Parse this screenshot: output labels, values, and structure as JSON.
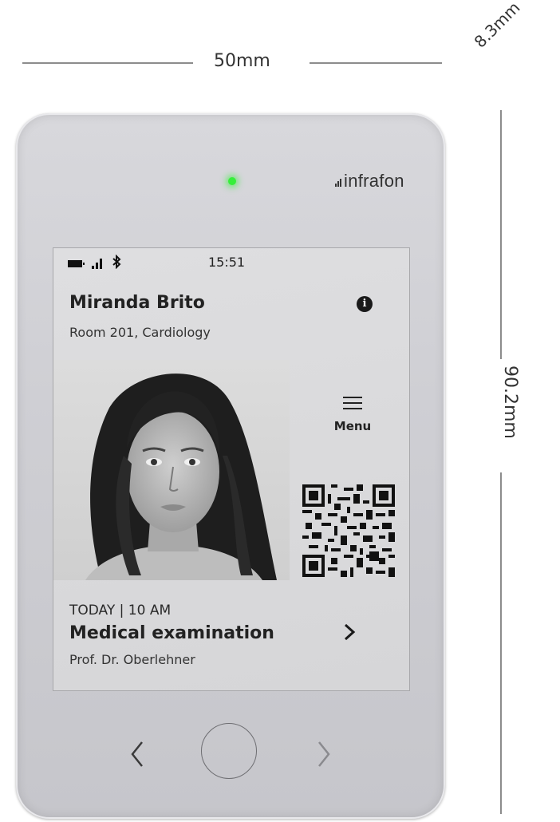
{
  "dimensions": {
    "width": "50mm",
    "height": "90.2mm",
    "depth": "8.3mm"
  },
  "device": {
    "brand": "infrafon",
    "led_color": "#36ef3a"
  },
  "status_bar": {
    "time": "15:51",
    "icons": [
      "battery-icon",
      "signal-icon",
      "bluetooth-icon"
    ]
  },
  "patient": {
    "name": "Miranda Brito",
    "room": "Room 201, Cardiology"
  },
  "menu": {
    "label": "Menu"
  },
  "appointment": {
    "time": "TODAY | 10 AM",
    "title": "Medical examination",
    "doctor": "Prof. Dr. Oberlehner"
  }
}
